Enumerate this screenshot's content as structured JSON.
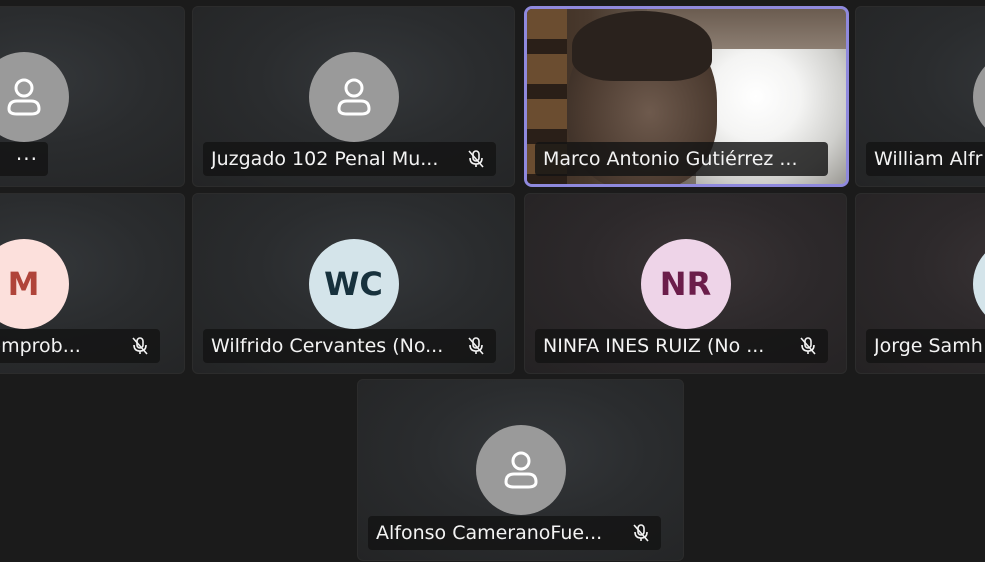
{
  "meeting": {
    "participants": [
      {
        "id": "p1",
        "name": "",
        "avatar_type": "generic",
        "muted": true,
        "show_more": true
      },
      {
        "id": "p2",
        "name": "Juzgado 102 Penal Mu...",
        "avatar_type": "generic",
        "muted": true
      },
      {
        "id": "p3",
        "name": "Marco Antonio Gutiérrez ...",
        "avatar_type": "video",
        "muted": false,
        "active_speaker": true
      },
      {
        "id": "p4",
        "name": "William Alfr",
        "avatar_type": "generic",
        "muted": false
      },
      {
        "id": "p5",
        "name": "comprob...",
        "avatar_type": "initials",
        "initials": "M",
        "avatar_bg": "#fce0dc",
        "avatar_fg": "#b0443a",
        "muted": true
      },
      {
        "id": "p6",
        "name": "Wilfrido Cervantes (No...",
        "avatar_type": "initials",
        "initials": "WC",
        "avatar_bg": "#d4e4ea",
        "avatar_fg": "#17313d",
        "muted": true
      },
      {
        "id": "p7",
        "name": "NINFA INES RUIZ (No ...",
        "avatar_type": "initials",
        "initials": "NR",
        "avatar_bg": "#eed4e8",
        "avatar_fg": "#6b1d4a",
        "muted": true
      },
      {
        "id": "p8",
        "name": "Jorge Samh",
        "avatar_type": "initials",
        "initials": "",
        "avatar_bg": "#d4e4ea",
        "avatar_fg": "#17313d",
        "muted": false
      },
      {
        "id": "p9",
        "name": "Alfonso CameranoFue...",
        "avatar_type": "generic",
        "muted": true
      }
    ],
    "icons": {
      "generic_avatar": "person-icon",
      "mic_muted": "mic-off-icon",
      "more": "more-options-icon"
    },
    "more_label": "···",
    "colors": {
      "background": "#1b1b1b",
      "active_border": "#8f89dd",
      "generic_avatar": "#9a9a9a"
    }
  }
}
